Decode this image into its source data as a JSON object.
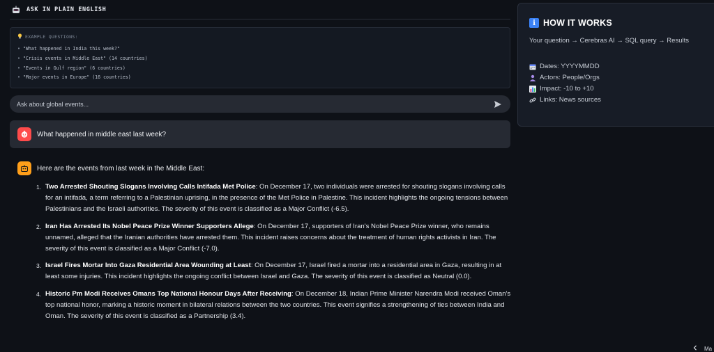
{
  "header": {
    "title": "ASK IN PLAIN ENGLISH"
  },
  "examples": {
    "title": "EXAMPLE QUESTIONS:",
    "items": [
      "\"What happened in India this week?\"",
      "\"Crisis events in Middle East\" (14 countries)",
      "\"Events in Gulf region\" (6 countries)",
      "\"Major events in Europe\" (16 countries)"
    ]
  },
  "chat": {
    "placeholder": "Ask about global events..."
  },
  "user_message": "What happened in middle east last week?",
  "bot_message": {
    "intro": "Here are the events from last week in the Middle East:",
    "events": [
      {
        "num": "1.",
        "title": "Two Arrested Shouting Slogans Involving Calls Intifada Met Police",
        "body": ": On December 17, two individuals were arrested for shouting slogans involving calls for an intifada, a term referring to a Palestinian uprising, in the presence of the Met Police in Palestine. This incident highlights the ongoing tensions between Palestinians and the Israeli authorities. The severity of this event is classified as a Major Conflict (-6.5)."
      },
      {
        "num": "2.",
        "title": "Iran Has Arrested Its Nobel Peace Prize Winner Supporters Allege",
        "body": ": On December 17, supporters of Iran's Nobel Peace Prize winner, who remains unnamed, alleged that the Iranian authorities have arrested them. This incident raises concerns about the treatment of human rights activists in Iran. The severity of this event is classified as a Major Conflict (-7.0)."
      },
      {
        "num": "3.",
        "title": "Israel Fires Mortar Into Gaza Residential Area Wounding at Least",
        "body": ": On December 17, Israel fired a mortar into a residential area in Gaza, resulting in at least some injuries. This incident highlights the ongoing conflict between Israel and Gaza. The severity of this event is classified as Neutral (0.0)."
      },
      {
        "num": "4.",
        "title": "Historic Pm Modi Receives Omans Top National Honour Days After Receiving",
        "body": ": On December 18, Indian Prime Minister Narendra Modi received Oman's top national honor, marking a historic moment in bilateral relations between the two countries. This event signifies a strengthening of ties between India and Oman. The severity of this event is classified as a Partnership (3.4)."
      }
    ]
  },
  "how_it_works": {
    "title": "HOW IT WORKS",
    "flow": "Your question → Cerebras AI → SQL query → Results",
    "items": [
      {
        "icon": "calendar-icon",
        "label": "Dates: YYYYMMDD"
      },
      {
        "icon": "person-icon",
        "label": "Actors: People/Orgs"
      },
      {
        "icon": "bar-chart-icon",
        "label": "Impact: -10 to +10"
      },
      {
        "icon": "link-icon",
        "label": "Links: News sources"
      }
    ]
  },
  "bottom_nav": {
    "label": "Ma"
  },
  "colors": {
    "user_avatar": "#ff4b4b",
    "bot_avatar": "#ff9f1a",
    "info_blue": "#3b82f6",
    "background": "#0e1117"
  }
}
